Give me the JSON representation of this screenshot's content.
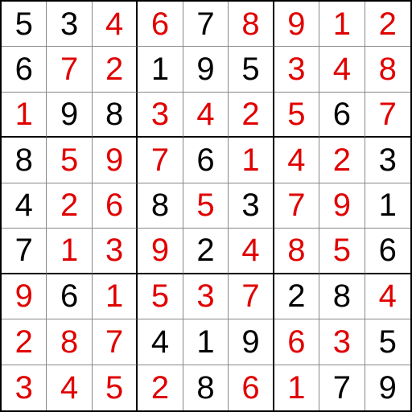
{
  "sudoku": {
    "grid": [
      [
        {
          "v": "5",
          "t": "given"
        },
        {
          "v": "3",
          "t": "given"
        },
        {
          "v": "4",
          "t": "solved"
        },
        {
          "v": "6",
          "t": "solved"
        },
        {
          "v": "7",
          "t": "given"
        },
        {
          "v": "8",
          "t": "solved"
        },
        {
          "v": "9",
          "t": "solved"
        },
        {
          "v": "1",
          "t": "solved"
        },
        {
          "v": "2",
          "t": "solved"
        }
      ],
      [
        {
          "v": "6",
          "t": "given"
        },
        {
          "v": "7",
          "t": "solved"
        },
        {
          "v": "2",
          "t": "solved"
        },
        {
          "v": "1",
          "t": "given"
        },
        {
          "v": "9",
          "t": "given"
        },
        {
          "v": "5",
          "t": "given"
        },
        {
          "v": "3",
          "t": "solved"
        },
        {
          "v": "4",
          "t": "solved"
        },
        {
          "v": "8",
          "t": "solved"
        }
      ],
      [
        {
          "v": "1",
          "t": "solved"
        },
        {
          "v": "9",
          "t": "given"
        },
        {
          "v": "8",
          "t": "given"
        },
        {
          "v": "3",
          "t": "solved"
        },
        {
          "v": "4",
          "t": "solved"
        },
        {
          "v": "2",
          "t": "solved"
        },
        {
          "v": "5",
          "t": "solved"
        },
        {
          "v": "6",
          "t": "given"
        },
        {
          "v": "7",
          "t": "solved"
        }
      ],
      [
        {
          "v": "8",
          "t": "given"
        },
        {
          "v": "5",
          "t": "solved"
        },
        {
          "v": "9",
          "t": "solved"
        },
        {
          "v": "7",
          "t": "solved"
        },
        {
          "v": "6",
          "t": "given"
        },
        {
          "v": "1",
          "t": "solved"
        },
        {
          "v": "4",
          "t": "solved"
        },
        {
          "v": "2",
          "t": "solved"
        },
        {
          "v": "3",
          "t": "given"
        }
      ],
      [
        {
          "v": "4",
          "t": "given"
        },
        {
          "v": "2",
          "t": "solved"
        },
        {
          "v": "6",
          "t": "solved"
        },
        {
          "v": "8",
          "t": "given"
        },
        {
          "v": "5",
          "t": "solved"
        },
        {
          "v": "3",
          "t": "given"
        },
        {
          "v": "7",
          "t": "solved"
        },
        {
          "v": "9",
          "t": "solved"
        },
        {
          "v": "1",
          "t": "given"
        }
      ],
      [
        {
          "v": "7",
          "t": "given"
        },
        {
          "v": "1",
          "t": "solved"
        },
        {
          "v": "3",
          "t": "solved"
        },
        {
          "v": "9",
          "t": "solved"
        },
        {
          "v": "2",
          "t": "given"
        },
        {
          "v": "4",
          "t": "solved"
        },
        {
          "v": "8",
          "t": "solved"
        },
        {
          "v": "5",
          "t": "solved"
        },
        {
          "v": "6",
          "t": "given"
        }
      ],
      [
        {
          "v": "9",
          "t": "solved"
        },
        {
          "v": "6",
          "t": "given"
        },
        {
          "v": "1",
          "t": "solved"
        },
        {
          "v": "5",
          "t": "solved"
        },
        {
          "v": "3",
          "t": "solved"
        },
        {
          "v": "7",
          "t": "solved"
        },
        {
          "v": "2",
          "t": "given"
        },
        {
          "v": "8",
          "t": "given"
        },
        {
          "v": "4",
          "t": "solved"
        }
      ],
      [
        {
          "v": "2",
          "t": "solved"
        },
        {
          "v": "8",
          "t": "solved"
        },
        {
          "v": "7",
          "t": "solved"
        },
        {
          "v": "4",
          "t": "given"
        },
        {
          "v": "1",
          "t": "given"
        },
        {
          "v": "9",
          "t": "given"
        },
        {
          "v": "6",
          "t": "solved"
        },
        {
          "v": "3",
          "t": "solved"
        },
        {
          "v": "5",
          "t": "given"
        }
      ],
      [
        {
          "v": "3",
          "t": "solved"
        },
        {
          "v": "4",
          "t": "solved"
        },
        {
          "v": "5",
          "t": "solved"
        },
        {
          "v": "2",
          "t": "solved"
        },
        {
          "v": "8",
          "t": "given"
        },
        {
          "v": "6",
          "t": "solved"
        },
        {
          "v": "1",
          "t": "solved"
        },
        {
          "v": "7",
          "t": "given"
        },
        {
          "v": "9",
          "t": "given"
        }
      ]
    ]
  }
}
